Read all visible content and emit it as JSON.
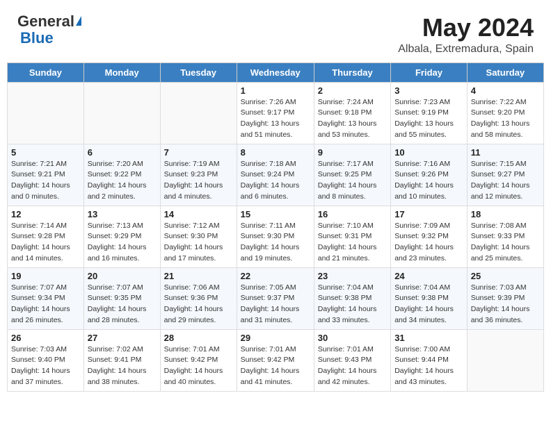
{
  "header": {
    "logo": {
      "general": "General",
      "blue": "Blue"
    },
    "title": "May 2024",
    "location": "Albala, Extremadura, Spain"
  },
  "calendar": {
    "days_of_week": [
      "Sunday",
      "Monday",
      "Tuesday",
      "Wednesday",
      "Thursday",
      "Friday",
      "Saturday"
    ],
    "weeks": [
      [
        {
          "day": "",
          "info": ""
        },
        {
          "day": "",
          "info": ""
        },
        {
          "day": "",
          "info": ""
        },
        {
          "day": "1",
          "info": "Sunrise: 7:26 AM\nSunset: 9:17 PM\nDaylight: 13 hours\nand 51 minutes."
        },
        {
          "day": "2",
          "info": "Sunrise: 7:24 AM\nSunset: 9:18 PM\nDaylight: 13 hours\nand 53 minutes."
        },
        {
          "day": "3",
          "info": "Sunrise: 7:23 AM\nSunset: 9:19 PM\nDaylight: 13 hours\nand 55 minutes."
        },
        {
          "day": "4",
          "info": "Sunrise: 7:22 AM\nSunset: 9:20 PM\nDaylight: 13 hours\nand 58 minutes."
        }
      ],
      [
        {
          "day": "5",
          "info": "Sunrise: 7:21 AM\nSunset: 9:21 PM\nDaylight: 14 hours\nand 0 minutes."
        },
        {
          "day": "6",
          "info": "Sunrise: 7:20 AM\nSunset: 9:22 PM\nDaylight: 14 hours\nand 2 minutes."
        },
        {
          "day": "7",
          "info": "Sunrise: 7:19 AM\nSunset: 9:23 PM\nDaylight: 14 hours\nand 4 minutes."
        },
        {
          "day": "8",
          "info": "Sunrise: 7:18 AM\nSunset: 9:24 PM\nDaylight: 14 hours\nand 6 minutes."
        },
        {
          "day": "9",
          "info": "Sunrise: 7:17 AM\nSunset: 9:25 PM\nDaylight: 14 hours\nand 8 minutes."
        },
        {
          "day": "10",
          "info": "Sunrise: 7:16 AM\nSunset: 9:26 PM\nDaylight: 14 hours\nand 10 minutes."
        },
        {
          "day": "11",
          "info": "Sunrise: 7:15 AM\nSunset: 9:27 PM\nDaylight: 14 hours\nand 12 minutes."
        }
      ],
      [
        {
          "day": "12",
          "info": "Sunrise: 7:14 AM\nSunset: 9:28 PM\nDaylight: 14 hours\nand 14 minutes."
        },
        {
          "day": "13",
          "info": "Sunrise: 7:13 AM\nSunset: 9:29 PM\nDaylight: 14 hours\nand 16 minutes."
        },
        {
          "day": "14",
          "info": "Sunrise: 7:12 AM\nSunset: 9:30 PM\nDaylight: 14 hours\nand 17 minutes."
        },
        {
          "day": "15",
          "info": "Sunrise: 7:11 AM\nSunset: 9:30 PM\nDaylight: 14 hours\nand 19 minutes."
        },
        {
          "day": "16",
          "info": "Sunrise: 7:10 AM\nSunset: 9:31 PM\nDaylight: 14 hours\nand 21 minutes."
        },
        {
          "day": "17",
          "info": "Sunrise: 7:09 AM\nSunset: 9:32 PM\nDaylight: 14 hours\nand 23 minutes."
        },
        {
          "day": "18",
          "info": "Sunrise: 7:08 AM\nSunset: 9:33 PM\nDaylight: 14 hours\nand 25 minutes."
        }
      ],
      [
        {
          "day": "19",
          "info": "Sunrise: 7:07 AM\nSunset: 9:34 PM\nDaylight: 14 hours\nand 26 minutes."
        },
        {
          "day": "20",
          "info": "Sunrise: 7:07 AM\nSunset: 9:35 PM\nDaylight: 14 hours\nand 28 minutes."
        },
        {
          "day": "21",
          "info": "Sunrise: 7:06 AM\nSunset: 9:36 PM\nDaylight: 14 hours\nand 29 minutes."
        },
        {
          "day": "22",
          "info": "Sunrise: 7:05 AM\nSunset: 9:37 PM\nDaylight: 14 hours\nand 31 minutes."
        },
        {
          "day": "23",
          "info": "Sunrise: 7:04 AM\nSunset: 9:38 PM\nDaylight: 14 hours\nand 33 minutes."
        },
        {
          "day": "24",
          "info": "Sunrise: 7:04 AM\nSunset: 9:38 PM\nDaylight: 14 hours\nand 34 minutes."
        },
        {
          "day": "25",
          "info": "Sunrise: 7:03 AM\nSunset: 9:39 PM\nDaylight: 14 hours\nand 36 minutes."
        }
      ],
      [
        {
          "day": "26",
          "info": "Sunrise: 7:03 AM\nSunset: 9:40 PM\nDaylight: 14 hours\nand 37 minutes."
        },
        {
          "day": "27",
          "info": "Sunrise: 7:02 AM\nSunset: 9:41 PM\nDaylight: 14 hours\nand 38 minutes."
        },
        {
          "day": "28",
          "info": "Sunrise: 7:01 AM\nSunset: 9:42 PM\nDaylight: 14 hours\nand 40 minutes."
        },
        {
          "day": "29",
          "info": "Sunrise: 7:01 AM\nSunset: 9:42 PM\nDaylight: 14 hours\nand 41 minutes."
        },
        {
          "day": "30",
          "info": "Sunrise: 7:01 AM\nSunset: 9:43 PM\nDaylight: 14 hours\nand 42 minutes."
        },
        {
          "day": "31",
          "info": "Sunrise: 7:00 AM\nSunset: 9:44 PM\nDaylight: 14 hours\nand 43 minutes."
        },
        {
          "day": "",
          "info": ""
        }
      ]
    ]
  }
}
